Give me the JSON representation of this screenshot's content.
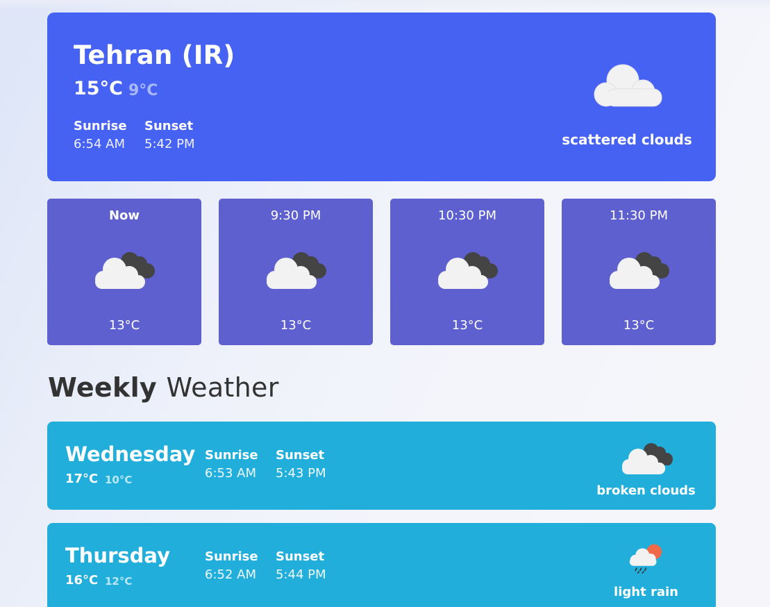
{
  "current": {
    "city": "Tehran (IR)",
    "temp": "15°C",
    "temp_low": "9°C",
    "sunrise_label": "Sunrise",
    "sunrise": "6:54 AM",
    "sunset_label": "Sunset",
    "sunset": "5:42 PM",
    "condition": "scattered clouds",
    "icon": "scattered-clouds-icon"
  },
  "hourly": [
    {
      "time": "Now",
      "temp": "13°C",
      "icon": "broken-clouds-icon"
    },
    {
      "time": "9:30 PM",
      "temp": "13°C",
      "icon": "broken-clouds-icon"
    },
    {
      "time": "10:30 PM",
      "temp": "13°C",
      "icon": "broken-clouds-icon"
    },
    {
      "time": "11:30 PM",
      "temp": "13°C",
      "icon": "broken-clouds-icon"
    }
  ],
  "weekly": {
    "title_bold": "Weekly",
    "title_rest": "Weather",
    "days": [
      {
        "name": "Wednesday",
        "temp": "17°C",
        "temp_low": "10°C",
        "sunrise_label": "Sunrise",
        "sunrise": "6:53 AM",
        "sunset_label": "Sunset",
        "sunset": "5:43 PM",
        "condition": "broken clouds",
        "icon": "broken-clouds-icon"
      },
      {
        "name": "Thursday",
        "temp": "16°C",
        "temp_low": "12°C",
        "sunrise_label": "Sunrise",
        "sunrise": "6:52 AM",
        "sunset_label": "Sunset",
        "sunset": "5:44 PM",
        "condition": "light rain",
        "icon": "light-rain-icon"
      }
    ]
  },
  "colors": {
    "current_card": "#4562f2",
    "hourly_card": "#5e60cf",
    "day_card": "#22aedb"
  }
}
